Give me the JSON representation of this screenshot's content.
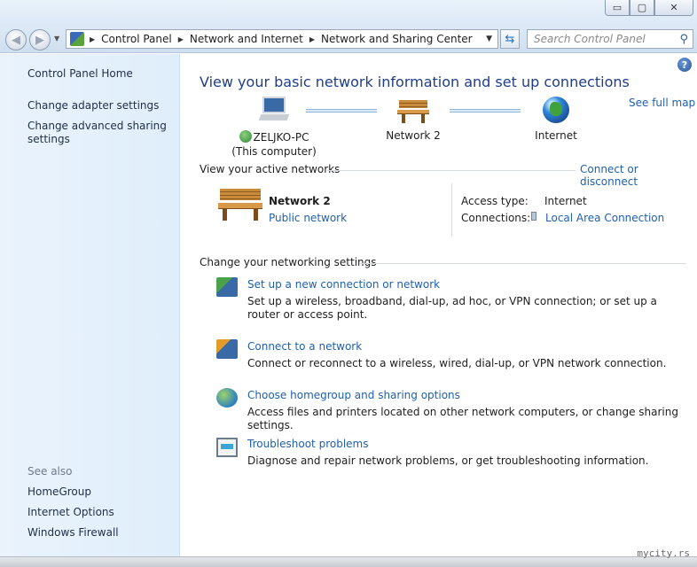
{
  "window": {
    "minimize_glyph": "▭",
    "maximize_glyph": "▢",
    "close_glyph": "✕"
  },
  "address": {
    "crumbs": [
      "Control Panel",
      "Network and Internet",
      "Network and Sharing Center"
    ],
    "search_placeholder": "Search Control Panel",
    "back_icon": "back-arrow-icon",
    "forward_icon": "forward-arrow-icon"
  },
  "sidebar": {
    "home": "Control Panel Home",
    "adapter": "Change adapter settings",
    "advanced": "Change advanced sharing settings",
    "see_also": "See also",
    "homegroup": "HomeGroup",
    "internet_options": "Internet Options",
    "firewall": "Windows Firewall"
  },
  "main": {
    "heading": "View your basic network information and set up connections",
    "see_full_map": "See full map",
    "map": {
      "computer_name": "ZELJKO-PC",
      "computer_sub": "(This computer)",
      "network": "Network  2",
      "internet": "Internet"
    },
    "active": {
      "title": "View your active networks",
      "connect_link": "Connect or disconnect",
      "network_name": "Network  2",
      "network_type": "Public network",
      "access_type_label": "Access type:",
      "access_type_value": "Internet",
      "connections_label": "Connections:",
      "connections_value": "Local Area Connection"
    },
    "settings": {
      "title": "Change your networking settings",
      "tasks": [
        {
          "link": "Set up a new connection or network",
          "desc": "Set up a wireless, broadband, dial-up, ad hoc, or VPN connection; or set up a router or access point."
        },
        {
          "link": "Connect to a network",
          "desc": "Connect or reconnect to a wireless, wired, dial-up, or VPN network connection."
        },
        {
          "link": "Choose homegroup and sharing options",
          "desc": "Access files and printers located on other network computers, or change sharing settings."
        },
        {
          "link": "Troubleshoot problems",
          "desc": "Diagnose and repair network problems, or get troubleshooting information."
        }
      ]
    }
  },
  "watermark": "mycity.rs"
}
